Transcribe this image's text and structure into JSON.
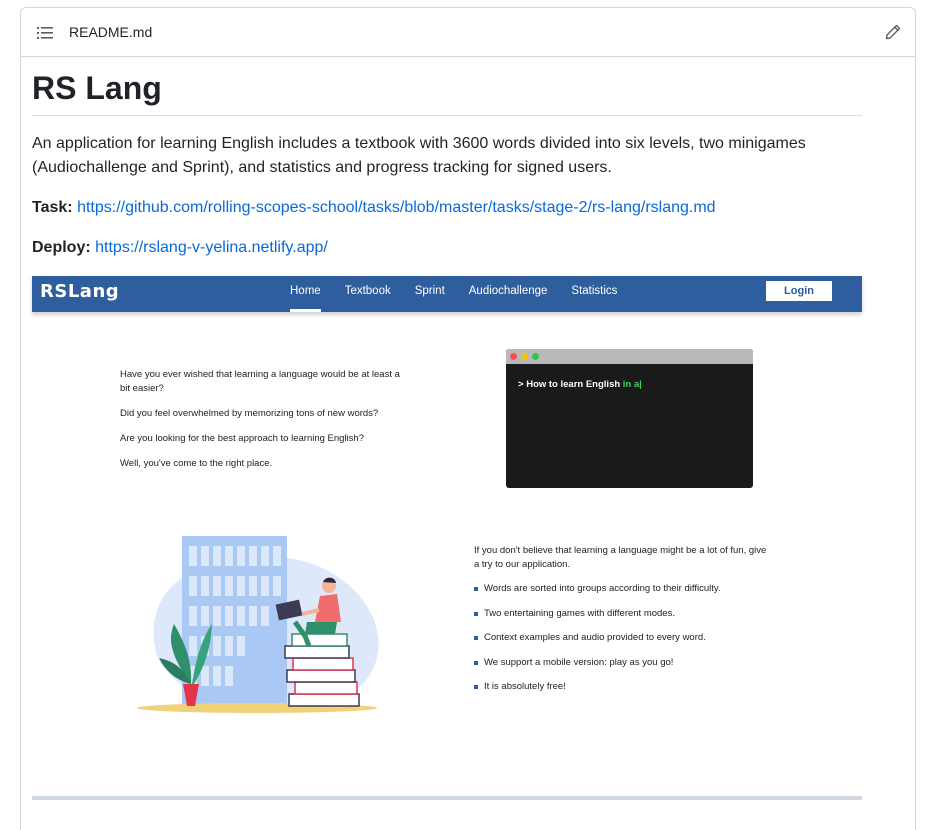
{
  "header": {
    "file_name": "README.md"
  },
  "readme": {
    "title": "RS Lang",
    "description": "An application for learning English includes a textbook with 3600 words divided into six levels, two minigames (Audiochallenge and Sprint), and statistics and progress tracking for signed users.",
    "task_label": "Task:",
    "task_link": "https://github.com/rolling-scopes-school/tasks/blob/master/tasks/stage-2/rs-lang/rslang.md",
    "deploy_label": "Deploy:",
    "deploy_link": "https://rslang-v-yelina.netlify.app/"
  },
  "screenshot": {
    "logo": "RSLang",
    "menu": [
      "Home",
      "Textbook",
      "Sprint",
      "Audiochallenge",
      "Statistics"
    ],
    "active_menu": "Home",
    "login_label": "Login",
    "intro": [
      "Have you ever wished that learning a language would be at least a bit easier?",
      "Did you feel overwhelmed by memorizing tons of new words?",
      "Are you looking for the best approach to learning English?",
      "Well, you've come to the right place."
    ],
    "terminal": {
      "prompt": ">",
      "text_white": "How to learn English",
      "text_green": "in a"
    },
    "features_lead": "If you don't believe that learning a language might be a lot of fun, give a try to our application.",
    "features": [
      "Words are sorted into groups according to their difficulty.",
      "Two entertaining games with different modes.",
      "Context examples and audio provided to every word.",
      "We support a mobile version: play as you go!",
      "It is absolutely free!"
    ],
    "colors": {
      "nav": "#2f5e9e",
      "terminal_bg": "#1a1a1a",
      "terminal_green": "#3ecf5a",
      "dot_red": "#ff4d4d",
      "dot_yellow": "#f5c400",
      "dot_green": "#2ec94a"
    }
  },
  "colors": {
    "link": "#0969da",
    "border": "#d0d7de"
  }
}
